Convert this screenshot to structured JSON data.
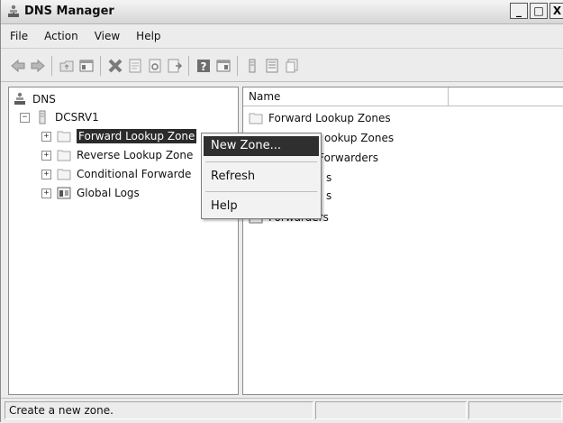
{
  "window": {
    "title": "DNS Manager",
    "buttons": [
      "_",
      "□",
      "X"
    ]
  },
  "menubar": {
    "items": [
      "File",
      "Action",
      "View",
      "Help"
    ]
  },
  "toolbar": {
    "icons": [
      "back-arrow-icon",
      "forward-arrow-icon",
      "up-folder-icon",
      "show-hide-console-tree-icon",
      "delete-icon",
      "properties-icon",
      "refresh-icon",
      "export-list-icon",
      "help-icon",
      "action-pane-icon",
      "server-icon",
      "list-icon",
      "copy-icon"
    ]
  },
  "tree": {
    "root": "DNS",
    "server": "DCSRV1",
    "children": [
      {
        "label": "Forward Lookup Zones",
        "display": "Forward Lookup Zone",
        "selected": true
      },
      {
        "label": "Reverse Lookup Zones",
        "display": "Reverse Lookup Zone"
      },
      {
        "label": "Conditional Forwarders",
        "display": "Conditional Forwarde"
      },
      {
        "label": "Global Logs",
        "display": "Global Logs"
      }
    ]
  },
  "list": {
    "column": "Name",
    "rows": [
      {
        "visible": "Forward Lookup Zones"
      },
      {
        "visible": "ookup Zones"
      },
      {
        "visible": "l Forwarders"
      },
      {
        "visible": "s"
      },
      {
        "visible": "s"
      },
      {
        "visible": "Forwarders"
      }
    ]
  },
  "context_menu": {
    "items": [
      "New Zone...",
      "Refresh",
      "Help"
    ]
  },
  "status": {
    "text": "Create a new zone."
  }
}
